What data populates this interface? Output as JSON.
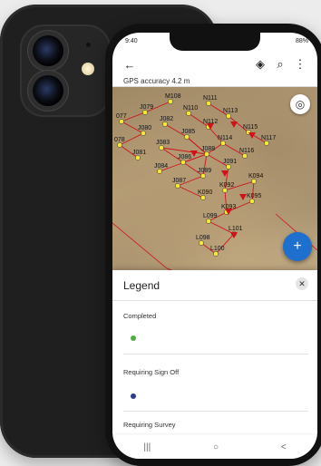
{
  "status_bar": {
    "time": "9:40",
    "battery": "88%"
  },
  "toolbar": {
    "back_icon": "arrow-left-icon",
    "layers_icon": "layers-icon",
    "search_icon": "search-icon",
    "more_icon": "more-vert-icon"
  },
  "gps": {
    "text": "GPS accuracy 4.2 m"
  },
  "map": {
    "labels": [
      "M108",
      "N111",
      "J079",
      "N110",
      "N113",
      "077",
      "J082",
      "N112",
      "N115",
      "J080",
      "J085",
      "N114",
      "N117",
      "078",
      "J083",
      "J088",
      "N116",
      "J081",
      "J086",
      "J091",
      "J084",
      "J089",
      "K094",
      "J087",
      "K092",
      "K090",
      "K095",
      "K093",
      "L099",
      "L101",
      "L098",
      "L100"
    ],
    "locate_icon": "crosshair-icon"
  },
  "fab": {
    "icon": "plus-icon",
    "label": "+"
  },
  "legend": {
    "title": "Legend",
    "close_icon": "close-icon",
    "sections": [
      {
        "label": "Completed",
        "color": "#4caf3f"
      },
      {
        "label": "Requiring Sign Off",
        "color": "#2e3c8c"
      },
      {
        "label": "Requiring Survey",
        "color": "#cccc00"
      }
    ]
  },
  "navbar": {
    "recent": "|||",
    "home": "○",
    "back": "<"
  },
  "colors": {
    "accent": "#1e6fce",
    "line": "#d0121a",
    "point": "#f5e83a"
  }
}
